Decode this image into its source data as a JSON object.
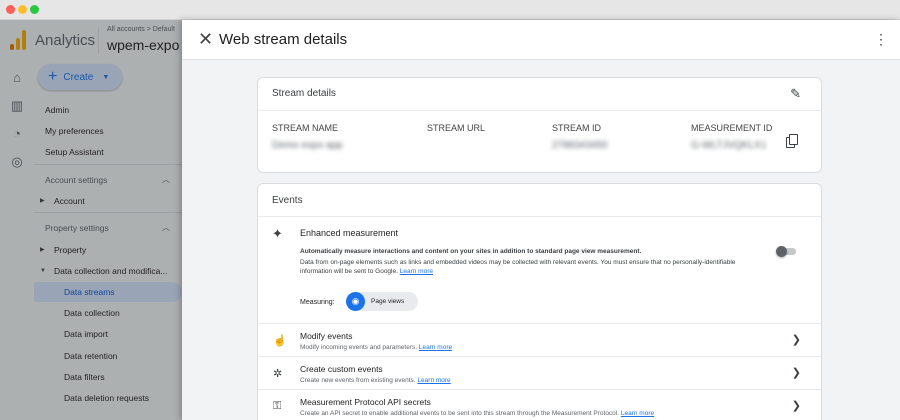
{
  "window": {
    "controls": [
      "close",
      "minimize",
      "maximize"
    ]
  },
  "app": {
    "name": "Analytics",
    "account_crumb": "All accounts > Default",
    "property_name": "wpem-expo"
  },
  "create_button": {
    "label": "Create"
  },
  "nav": {
    "admin": "Admin",
    "my_preferences": "My preferences",
    "setup_assistant": "Setup Assistant",
    "account_settings": "Account settings",
    "account": "Account",
    "property_settings": "Property settings",
    "property": "Property",
    "data_collection": "Data collection and modifica...",
    "data_streams": "Data streams",
    "data_collection_sub": "Data collection",
    "data_import": "Data import",
    "data_retention": "Data retention",
    "data_filters": "Data filters",
    "data_deletion_requests": "Data deletion requests"
  },
  "panel": {
    "title": "Web stream details"
  },
  "stream_details": {
    "title": "Stream details",
    "columns": [
      {
        "label": "STREAM NAME",
        "value": "Demo expo app"
      },
      {
        "label": "STREAM URL",
        "value": ""
      },
      {
        "label": "STREAM ID",
        "value": "2788343450"
      },
      {
        "label": "MEASUREMENT ID",
        "value": "G-WLTJVQKLX1"
      }
    ]
  },
  "events": {
    "title": "Events",
    "enhanced": {
      "title": "Enhanced measurement",
      "desc_bold": "Automatically measure interactions and content on your sites in addition to standard page view measurement.",
      "desc_body": "Data from on-page elements such as links and embedded videos may be collected with relevant events. You must ensure that no personally-identifiable information will be sent to Google.",
      "learn_more": "Learn more",
      "toggle_on": false,
      "measuring_label": "Measuring:",
      "chip_label": "Page views"
    },
    "rows": [
      {
        "title": "Modify events",
        "desc": "Modify incoming events and parameters.",
        "link": "Learn more"
      },
      {
        "title": "Create custom events",
        "desc": "Create new events from existing events.",
        "link": "Learn more"
      },
      {
        "title": "Measurement Protocol API secrets",
        "desc": "Create an API secret to enable additional events to be sent into this stream through the Measurement Protocol.",
        "link": "Learn more"
      }
    ]
  },
  "colors": {
    "accent": "#1a73e8",
    "active_bg": "#d3e3fd",
    "logo_orange": "#f9ab00"
  }
}
